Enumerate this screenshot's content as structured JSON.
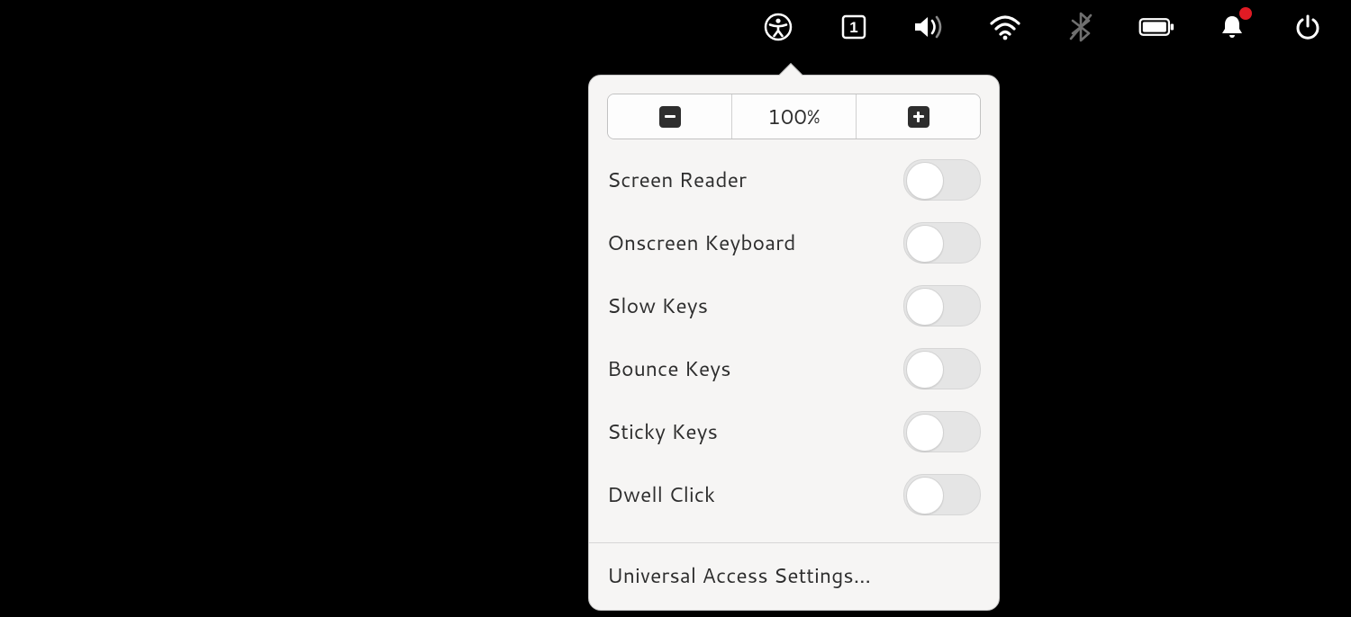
{
  "menubar": {
    "items": [
      {
        "name": "accessibility-icon",
        "active": true
      },
      {
        "name": "keyboard-layout-icon",
        "badge": "1"
      },
      {
        "name": "volume-icon"
      },
      {
        "name": "wifi-icon"
      },
      {
        "name": "bluetooth-icon",
        "disabled": true
      },
      {
        "name": "battery-icon"
      },
      {
        "name": "notifications-icon",
        "has_alert": true
      },
      {
        "name": "power-icon"
      }
    ]
  },
  "popover": {
    "zoom": {
      "decrease_label": "-",
      "level_label": "100%",
      "increase_label": "+"
    },
    "toggles": [
      {
        "label": "Screen Reader",
        "on": false
      },
      {
        "label": "Onscreen Keyboard",
        "on": false
      },
      {
        "label": "Slow Keys",
        "on": false
      },
      {
        "label": "Bounce Keys",
        "on": false
      },
      {
        "label": "Sticky Keys",
        "on": false
      },
      {
        "label": "Dwell Click",
        "on": false
      }
    ],
    "settings_label": "Universal Access Settings..."
  }
}
